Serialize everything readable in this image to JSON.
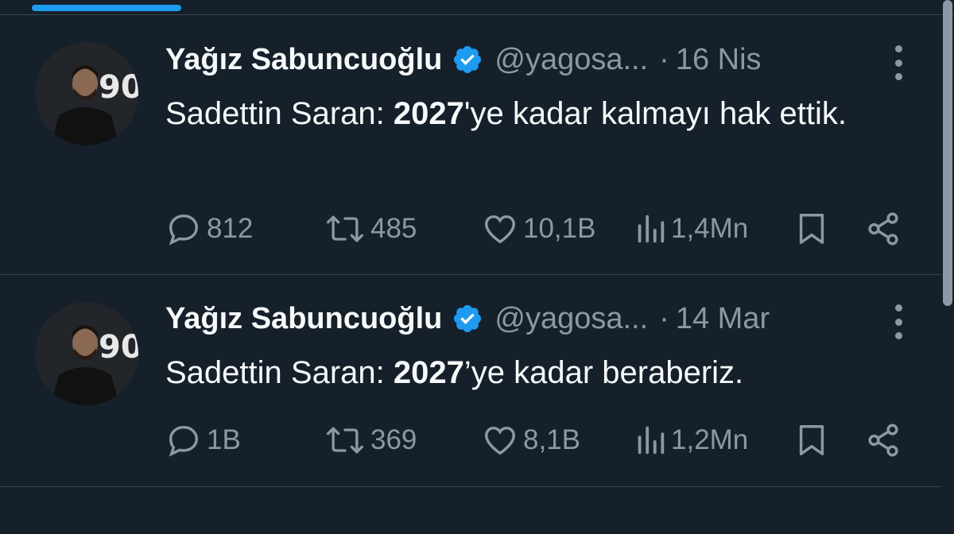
{
  "tweets": [
    {
      "name": "Yağız Sabuncuoğlu",
      "handle": "@yagosa...",
      "dot": "·",
      "date": "16 Nis",
      "text_before": "Sadettin Saran: ",
      "text_bold": "2027",
      "text_after": "'ye kadar kalmayı hak ettik.",
      "replies": "812",
      "retweets": "485",
      "likes": "10,1B",
      "views": "1,4Mn"
    },
    {
      "name": "Yağız Sabuncuoğlu",
      "handle": "@yagosa...",
      "dot": "·",
      "date": "14 Mar",
      "text_before": "Sadettin Saran: ",
      "text_bold": "2027",
      "text_after": "’ye kadar beraberiz.",
      "replies": "1B",
      "retweets": "369",
      "likes": "8,1B",
      "views": "1,2Mn"
    }
  ],
  "colors": {
    "background": "#15202b",
    "accent": "#1d9bf0",
    "muted": "#8b98a5",
    "divider": "#38444d"
  },
  "icons": [
    "reply-icon",
    "retweet-icon",
    "like-icon",
    "views-icon",
    "bookmark-icon",
    "share-icon",
    "verified-badge-icon",
    "more-icon"
  ]
}
